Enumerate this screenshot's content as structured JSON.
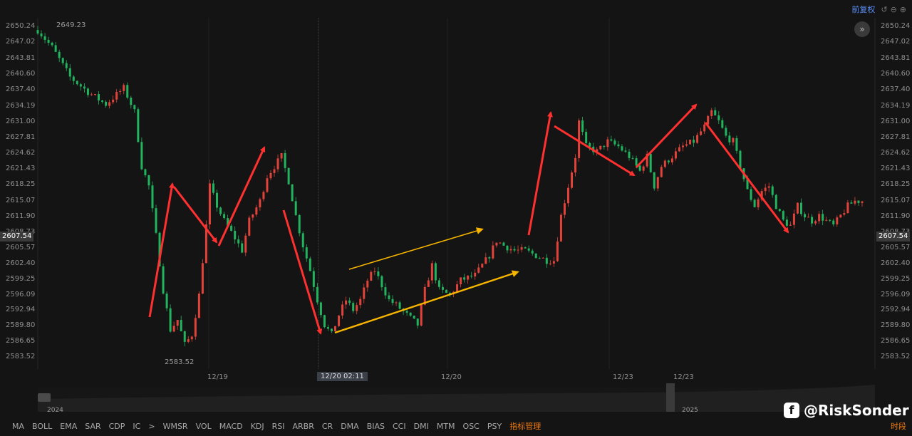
{
  "toolbar": {
    "fuquan_label": "前复权",
    "reset_icon": "reset-icon",
    "zoom_out_icon": "zoom-out-icon",
    "zoom_in_icon": "zoom-in-icon",
    "expand_glyph": "»"
  },
  "chart_data": {
    "type": "candlestick",
    "y_ticks": [
      "2650.24",
      "2647.02",
      "2643.81",
      "2640.60",
      "2637.40",
      "2634.19",
      "2631.00",
      "2627.81",
      "2624.62",
      "2621.43",
      "2618.25",
      "2615.07",
      "2611.90",
      "2608.73",
      "2605.57",
      "2602.40",
      "2599.25",
      "2596.09",
      "2592.94",
      "2589.80",
      "2586.65",
      "2583.52"
    ],
    "ylim": [
      2583.52,
      2650.24
    ],
    "current_price": "2607.54",
    "high_label": "2649.23",
    "low_label": "2583.52",
    "x_labels": [
      "12/19",
      "12/20 02:11",
      "12/20",
      "12/23",
      "12/23"
    ],
    "price_path": [
      [
        0,
        2649.5
      ],
      [
        4,
        2646
      ],
      [
        9,
        2640
      ],
      [
        14,
        2637
      ],
      [
        19,
        2634.5
      ],
      [
        22,
        2636.5
      ],
      [
        24,
        2637.8
      ],
      [
        27,
        2633
      ],
      [
        29,
        2622
      ],
      [
        31,
        2618
      ],
      [
        33,
        2608
      ],
      [
        35,
        2597
      ],
      [
        37,
        2589
      ],
      [
        39,
        2591
      ],
      [
        41,
        2586
      ],
      [
        43,
        2588
      ],
      [
        45,
        2596
      ],
      [
        47,
        2610
      ],
      [
        48,
        2618
      ],
      [
        50,
        2614
      ],
      [
        52,
        2611
      ],
      [
        55,
        2607.5
      ],
      [
        57,
        2605
      ],
      [
        59,
        2611
      ],
      [
        62,
        2615
      ],
      [
        64,
        2620
      ],
      [
        66,
        2622
      ],
      [
        68,
        2624
      ],
      [
        70,
        2619
      ],
      [
        72,
        2612
      ],
      [
        74,
        2606
      ],
      [
        76,
        2601
      ],
      [
        78,
        2595
      ],
      [
        80,
        2590
      ],
      [
        82,
        2588
      ],
      [
        84,
        2592
      ],
      [
        86,
        2595
      ],
      [
        88,
        2593
      ],
      [
        90,
        2595
      ],
      [
        92,
        2599
      ],
      [
        94,
        2601
      ],
      [
        96,
        2598
      ],
      [
        98,
        2595
      ],
      [
        100,
        2594
      ],
      [
        103,
        2592
      ],
      [
        106,
        2590
      ],
      [
        108,
        2597
      ],
      [
        110,
        2602
      ],
      [
        112,
        2597
      ],
      [
        115,
        2596
      ],
      [
        118,
        2599
      ],
      [
        122,
        2600
      ],
      [
        126,
        2604
      ],
      [
        128,
        2607
      ],
      [
        130,
        2606
      ],
      [
        133,
        2605
      ],
      [
        136,
        2605
      ],
      [
        139,
        2604
      ],
      [
        142,
        2603
      ],
      [
        144,
        2603
      ],
      [
        146,
        2612
      ],
      [
        148,
        2618
      ],
      [
        150,
        2624
      ],
      [
        151,
        2631
      ],
      [
        153,
        2626
      ],
      [
        156,
        2625
      ],
      [
        159,
        2627
      ],
      [
        162,
        2626
      ],
      [
        165,
        2624
      ],
      [
        168,
        2621
      ],
      [
        170,
        2624
      ],
      [
        172,
        2618
      ],
      [
        174,
        2622
      ],
      [
        177,
        2624
      ],
      [
        180,
        2626
      ],
      [
        183,
        2627
      ],
      [
        186,
        2630
      ],
      [
        188,
        2633
      ],
      [
        190,
        2631
      ],
      [
        192,
        2628
      ],
      [
        194,
        2627
      ],
      [
        196,
        2622
      ],
      [
        198,
        2617
      ],
      [
        200,
        2614
      ],
      [
        202,
        2617
      ],
      [
        204,
        2618
      ],
      [
        206,
        2614
      ],
      [
        208,
        2611
      ],
      [
        210,
        2610
      ],
      [
        212,
        2614
      ],
      [
        214,
        2612
      ],
      [
        216,
        2611
      ],
      [
        218,
        2612
      ],
      [
        220,
        2611
      ],
      [
        222,
        2610
      ],
      [
        224,
        2612
      ],
      [
        226,
        2614
      ],
      [
        228,
        2615
      ],
      [
        230,
        2615
      ]
    ],
    "annotations": [
      {
        "color": "#ff3030",
        "points": [
          [
            2592,
            2618
          ],
          [
            2618,
            2605
          ],
          [
            2605,
            2625
          ],
          [
            2625,
            2587
          ],
          [
            2631,
            2633
          ],
          [
            2633,
            2620
          ],
          [
            2620,
            2634
          ],
          [
            2634,
            2608
          ]
        ]
      },
      {
        "color": "#f7b500",
        "channel": true
      }
    ],
    "navigator_years": [
      "2024",
      "2025"
    ]
  },
  "indicators": [
    "MA",
    "BOLL",
    "EMA",
    "SAR",
    "CDP",
    "IC",
    "WMSR",
    "VOL",
    "MACD",
    "KDJ",
    "RSI",
    "ARBR",
    "CR",
    "DMA",
    "BIAS",
    "CCI",
    "DMI",
    "MTM",
    "OSC",
    "PSY"
  ],
  "indicator_arrow": ">",
  "indicator_manage": "指标管理",
  "time_share": "时段",
  "watermark": {
    "logo": "f",
    "handle": "@RiskSonder"
  }
}
